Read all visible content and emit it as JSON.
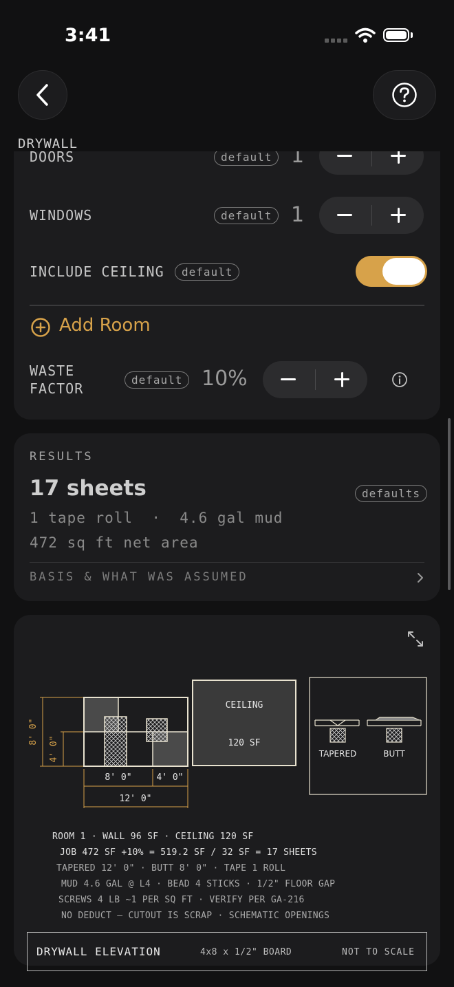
{
  "status_bar": {
    "time": "3:41"
  },
  "nav": {
    "title": "DRYWALL"
  },
  "inputs": {
    "doors": {
      "label": "DOORS",
      "badge": "default",
      "value": "1"
    },
    "windows": {
      "label": "WINDOWS",
      "badge": "default",
      "value": "1"
    },
    "include_ceiling": {
      "label": "INCLUDE CEILING",
      "badge": "default",
      "on": true
    },
    "add_room_label": "Add Room",
    "waste_factor": {
      "label_line1": "WASTE",
      "label_line2": "FACTOR",
      "badge": "default",
      "value": "10%"
    }
  },
  "results": {
    "title": "RESULTS",
    "sheets": "17 sheets",
    "badge": "defaults",
    "line1": "1 tape roll  ·  4.6 gal mud",
    "line2": "472 sq ft net area",
    "basis_link": "BASIS & WHAT WAS ASSUMED"
  },
  "drawing": {
    "dim_height_full": "8' 0\"",
    "dim_height_lower": "4' 0\"",
    "dim_width_8": "8' 0\"",
    "dim_width_4": "4' 0\"",
    "dim_width_total": "12' 0\"",
    "ceiling_label": "CEILING",
    "ceiling_area": "120 SF",
    "joint_tapered": "TAPERED",
    "joint_butt": "BUTT",
    "spec_lines": [
      "ROOM 1 · WALL 96 SF · CEILING 120 SF",
      "JOB 472 SF +10% = 519.2 SF / 32 SF = 17 SHEETS",
      "TAPERED 12' 0\" · BUTT 8' 0\" · TAPE 1 ROLL",
      "MUD 4.6 GAL @ L4 · BEAD 4 STICKS · 1/2\" FLOOR GAP",
      "SCREWS 4 LB ~1 PER SQ FT · VERIFY PER GA-216",
      "NO DEDUCT — CUTOUT IS SCRAP · SCHEMATIC OPENINGS"
    ],
    "footer_title": "DRYWALL ELEVATION",
    "footer_board": "4x8 x 1/2\" BOARD",
    "footer_scale": "NOT TO SCALE"
  },
  "colors": {
    "accent": "#d7a24a",
    "card": "#1c1c1e",
    "background": "#111112"
  }
}
